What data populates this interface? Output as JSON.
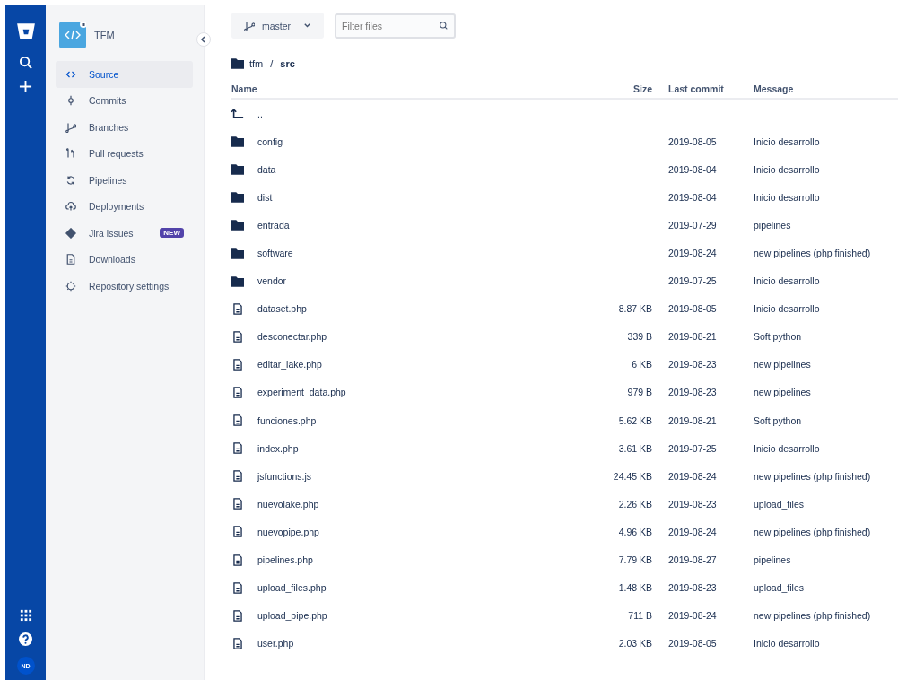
{
  "repository": {
    "name": "TFM"
  },
  "sidebar": {
    "items": [
      {
        "label": "Source",
        "selected": true
      },
      {
        "label": "Commits",
        "selected": false
      },
      {
        "label": "Branches",
        "selected": false
      },
      {
        "label": "Pull requests",
        "selected": false
      },
      {
        "label": "Pipelines",
        "selected": false
      },
      {
        "label": "Deployments",
        "selected": false
      },
      {
        "label": "Jira issues",
        "selected": false,
        "badge": "NEW"
      },
      {
        "label": "Downloads",
        "selected": false
      },
      {
        "label": "Repository settings",
        "selected": false
      }
    ]
  },
  "global_nav": {
    "avatar": "ND"
  },
  "branch": "master",
  "filter": {
    "placeholder": "Filter files"
  },
  "breadcrumb": {
    "items": [
      "tfm",
      "src"
    ],
    "separator": "/"
  },
  "table": {
    "columns": [
      "Name",
      "Size",
      "Last commit",
      "Message"
    ],
    "rows": [
      {
        "kind": "parent",
        "name": ".."
      },
      {
        "kind": "folder",
        "name": "config",
        "date": "2019-08-05",
        "message": "Inicio desarrollo"
      },
      {
        "kind": "folder",
        "name": "data",
        "date": "2019-08-04",
        "message": "Inicio desarrollo"
      },
      {
        "kind": "folder",
        "name": "dist",
        "date": "2019-08-04",
        "message": "Inicio desarrollo"
      },
      {
        "kind": "folder",
        "name": "entrada",
        "date": "2019-07-29",
        "message": "pipelines"
      },
      {
        "kind": "folder",
        "name": "software",
        "date": "2019-08-24",
        "message": "new pipelines (php finished)"
      },
      {
        "kind": "folder",
        "name": "vendor",
        "date": "2019-07-25",
        "message": "Inicio desarrollo"
      },
      {
        "kind": "file",
        "name": "dataset.php",
        "size": "8.87 KB",
        "date": "2019-08-05",
        "message": "Inicio desarrollo"
      },
      {
        "kind": "file",
        "name": "desconectar.php",
        "size": "339 B",
        "date": "2019-08-21",
        "message": "Soft python"
      },
      {
        "kind": "file",
        "name": "editar_lake.php",
        "size": "6 KB",
        "date": "2019-08-23",
        "message": "new pipelines"
      },
      {
        "kind": "file",
        "name": "experiment_data.php",
        "size": "979 B",
        "date": "2019-08-23",
        "message": "new pipelines"
      },
      {
        "kind": "file",
        "name": "funciones.php",
        "size": "5.62 KB",
        "date": "2019-08-21",
        "message": "Soft python"
      },
      {
        "kind": "file",
        "name": "index.php",
        "size": "3.61 KB",
        "date": "2019-07-25",
        "message": "Inicio desarrollo"
      },
      {
        "kind": "file",
        "name": "jsfunctions.js",
        "size": "24.45 KB",
        "date": "2019-08-24",
        "message": "new pipelines (php finished)"
      },
      {
        "kind": "file",
        "name": "nuevolake.php",
        "size": "2.26 KB",
        "date": "2019-08-23",
        "message": "upload_files"
      },
      {
        "kind": "file",
        "name": "nuevopipe.php",
        "size": "4.96 KB",
        "date": "2019-08-24",
        "message": "new pipelines (php finished)"
      },
      {
        "kind": "file",
        "name": "pipelines.php",
        "size": "7.79 KB",
        "date": "2019-08-27",
        "message": "pipelines"
      },
      {
        "kind": "file",
        "name": "upload_files.php",
        "size": "1.48 KB",
        "date": "2019-08-23",
        "message": "upload_files"
      },
      {
        "kind": "file",
        "name": "upload_pipe.php",
        "size": "711 B",
        "date": "2019-08-24",
        "message": "new pipelines (php finished)"
      },
      {
        "kind": "file",
        "name": "user.php",
        "size": "2.03 KB",
        "date": "2019-08-05",
        "message": "Inicio desarrollo"
      }
    ]
  }
}
